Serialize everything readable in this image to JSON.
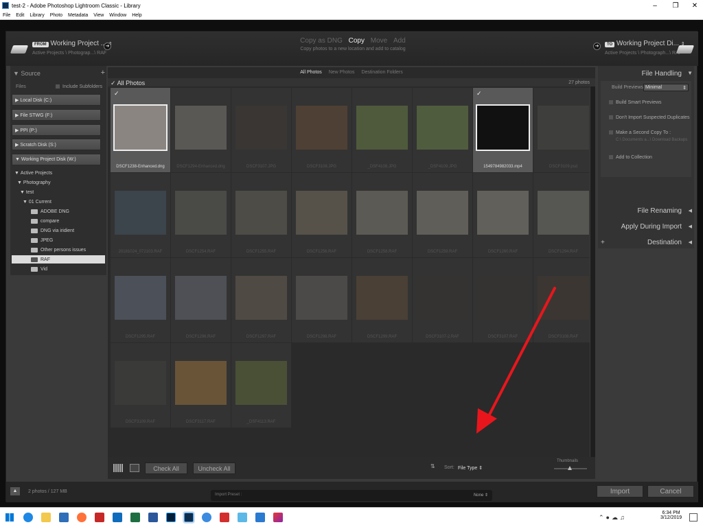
{
  "window": {
    "title": "test-2 - Adobe Photoshop Lightroom Classic - Library"
  },
  "menu": [
    "File",
    "Edit",
    "Library",
    "Photo",
    "Metadata",
    "View",
    "Window",
    "Help"
  ],
  "from": {
    "tag": "FROM",
    "title": "Working Project ...",
    "path": "Active Projects \\ Photograp...\\ RAF"
  },
  "to": {
    "tag": "TO",
    "title": "Working Project Di...",
    "path": "Active Projects \\ Photograph...\\ RAF"
  },
  "modes": {
    "items": [
      "Copy as DNG",
      "Copy",
      "Move",
      "Add"
    ],
    "active": "Copy",
    "description": "Copy photos to a new location and add to catalog"
  },
  "filter_tabs": [
    "All Photos",
    "New Photos",
    "Destination Folders"
  ],
  "source": {
    "title": "Source",
    "files_label": "Files",
    "include_subfolders": "Include Subfolders",
    "disks": [
      "Local Disk (C:)",
      "File STWG (F:)",
      "PPI (P:)",
      "Scratch Disk (S:)",
      "Working Project Disk (W:)"
    ],
    "tree": [
      {
        "label": "Active Projects",
        "type": "branch"
      },
      {
        "label": "Photography",
        "type": "branch"
      },
      {
        "label": "test",
        "type": "branch"
      },
      {
        "label": "01 Current",
        "type": "branch"
      },
      {
        "label": "ADOBE DNG",
        "type": "folder"
      },
      {
        "label": "compare",
        "type": "folder"
      },
      {
        "label": "DNG via iridient",
        "type": "folder"
      },
      {
        "label": "JPEG",
        "type": "folder"
      },
      {
        "label": "Other persons issues",
        "type": "folder"
      },
      {
        "label": "RAF",
        "type": "folder",
        "selected": true
      },
      {
        "label": "Vid",
        "type": "folder"
      }
    ]
  },
  "grid": {
    "header": "All Photos",
    "count": "27 photos",
    "photos": [
      {
        "name": "DSCF1238-Enhanced.dng",
        "color": "#8a8580",
        "checked": true,
        "highlight": true
      },
      {
        "name": "DSCF1294-Enhanced.dng",
        "color": "#5a5854"
      },
      {
        "name": "DSCF3107.JPG",
        "color": "#3a3634"
      },
      {
        "name": "DSCF3108.JPG",
        "color": "#4e4034"
      },
      {
        "name": "_DSF4108.JPG",
        "color": "#4f5a3c"
      },
      {
        "name": "_DSF4109.JPG",
        "color": "#505c3e"
      },
      {
        "name": "1549784982033.mp4",
        "color": "#111111",
        "checked": true,
        "highlight": true
      },
      {
        "name": "DSCF3109.psd",
        "color": "#3e3e3c"
      },
      {
        "name": "20181024_072103.RAF",
        "color": "#3c444c"
      },
      {
        "name": "DSCF1254.RAF",
        "color": "#4a4a46"
      },
      {
        "name": "DSCF1255.RAF",
        "color": "#4e4c46"
      },
      {
        "name": "DSCF1256.RAF",
        "color": "#56524a"
      },
      {
        "name": "DSCF1258.RAF",
        "color": "#5c5a54"
      },
      {
        "name": "DSCF1259.RAF",
        "color": "#605e58"
      },
      {
        "name": "DSCF1260.RAF",
        "color": "#62605a"
      },
      {
        "name": "DSCF1294.RAF",
        "color": "#565652"
      },
      {
        "name": "DSCF1295.RAF",
        "color": "#4c5058"
      },
      {
        "name": "DSCF1296.RAF",
        "color": "#4e5056"
      },
      {
        "name": "DSCF1297.RAF",
        "color": "#504a44"
      },
      {
        "name": "DSCF1298.RAF",
        "color": "#4c4a48"
      },
      {
        "name": "DSCF1299.RAF",
        "color": "#4a4036"
      },
      {
        "name": "DSCF3107-2.RAF",
        "color": "#353331"
      },
      {
        "name": "DSCF3107.RAF",
        "color": "#353331"
      },
      {
        "name": "DSCF3108.RAF",
        "color": "#3c3632"
      },
      {
        "name": "DSCF3109.RAF",
        "color": "#3a3a38"
      },
      {
        "name": "DSCF3117.RAF",
        "color": "#6a5438"
      },
      {
        "name": "_DSF4113.RAF",
        "color": "#4a5036"
      }
    ]
  },
  "toolbar": {
    "check_all": "Check All",
    "uncheck_all": "Uncheck All",
    "sort_label": "Sort:",
    "sort_value": "File Type",
    "thumbnails": "Thumbnails"
  },
  "file_handling": {
    "title": "File Handling",
    "build_previews_label": "Build Previews",
    "build_previews_value": "Minimal",
    "smart_previews": "Build Smart Previews",
    "no_duplicates": "Don't Import Suspected Duplicates",
    "second_copy": "Make a Second Copy To :",
    "second_copy_path": "C:\\ Documents a...\\ Download Backups",
    "add_collection": "Add to Collection"
  },
  "sections": [
    "File Renaming",
    "Apply During Import",
    "Destination"
  ],
  "footer": {
    "status": "2 photos / 127 MB",
    "preset_label": "Import Preset :",
    "preset_value": "None",
    "import": "Import",
    "cancel": "Cancel"
  },
  "clock": {
    "time": "6:34 PM",
    "date": "3/12/2019"
  }
}
